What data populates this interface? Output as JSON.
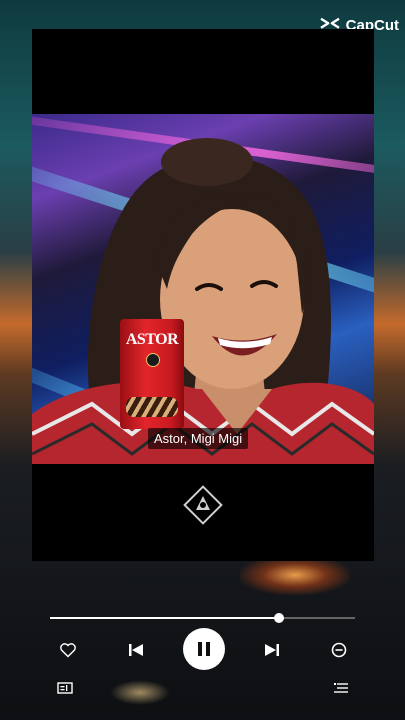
{
  "app": {
    "watermark": "CapCut"
  },
  "video": {
    "caption": "Astor, Migi Migi",
    "product_brand": "ASTOR"
  },
  "player": {
    "progress_fraction": 0.75,
    "state": "playing"
  },
  "icons": {
    "capcut": "capcut-logo-icon",
    "like": "heart-icon",
    "previous": "skip-previous-icon",
    "pause": "pause-icon",
    "next": "skip-next-icon",
    "minus": "minus-circle-icon",
    "lyrics": "lyrics-icon",
    "playlist": "playlist-icon"
  },
  "colors": {
    "accent": "#ffffff",
    "frame": "#000000"
  }
}
